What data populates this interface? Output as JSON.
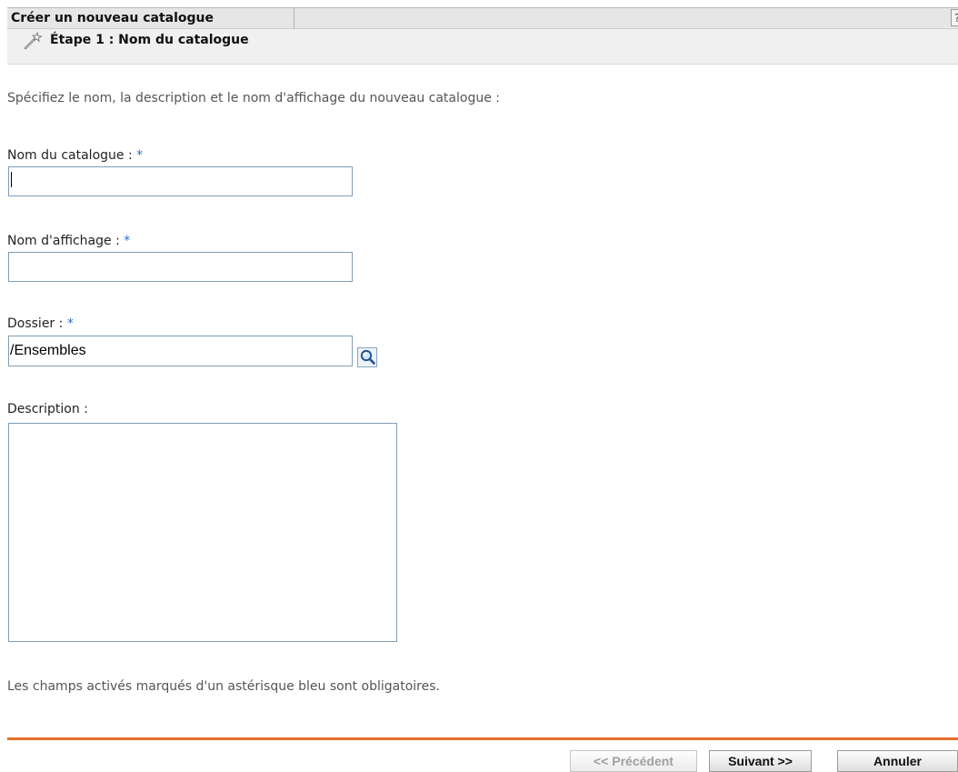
{
  "header": {
    "title": "Créer un nouveau catalogue",
    "help_label": "?"
  },
  "step": {
    "title": "Étape 1 : Nom du catalogue",
    "icon": "wizard-wand-icon"
  },
  "intro": "Spécifiez le nom, la description et le nom d'affichage du nouveau catalogue :",
  "required_marker": "*",
  "fields": {
    "catalog_name": {
      "label": "Nom du catalogue :",
      "value": "",
      "has_focus": true
    },
    "display_name": {
      "label": "Nom d'affichage :",
      "value": ""
    },
    "folder": {
      "label": "Dossier :",
      "value": "/Ensembles",
      "browse_icon": "magnifier-browse-icon"
    },
    "description": {
      "label": "Description :",
      "value": ""
    }
  },
  "note": "Les champs activés marqués d'un astérisque bleu sont obligatoires.",
  "buttons": {
    "previous": {
      "label": "<< Précédent",
      "enabled": false
    },
    "next": {
      "label": "Suivant >>",
      "enabled": true
    },
    "cancel": {
      "label": "Annuler",
      "enabled": true
    }
  },
  "colors": {
    "accent_line": "#e96d2a",
    "required_asterisk": "#2a6fc4",
    "input_border": "#7f9db9"
  }
}
